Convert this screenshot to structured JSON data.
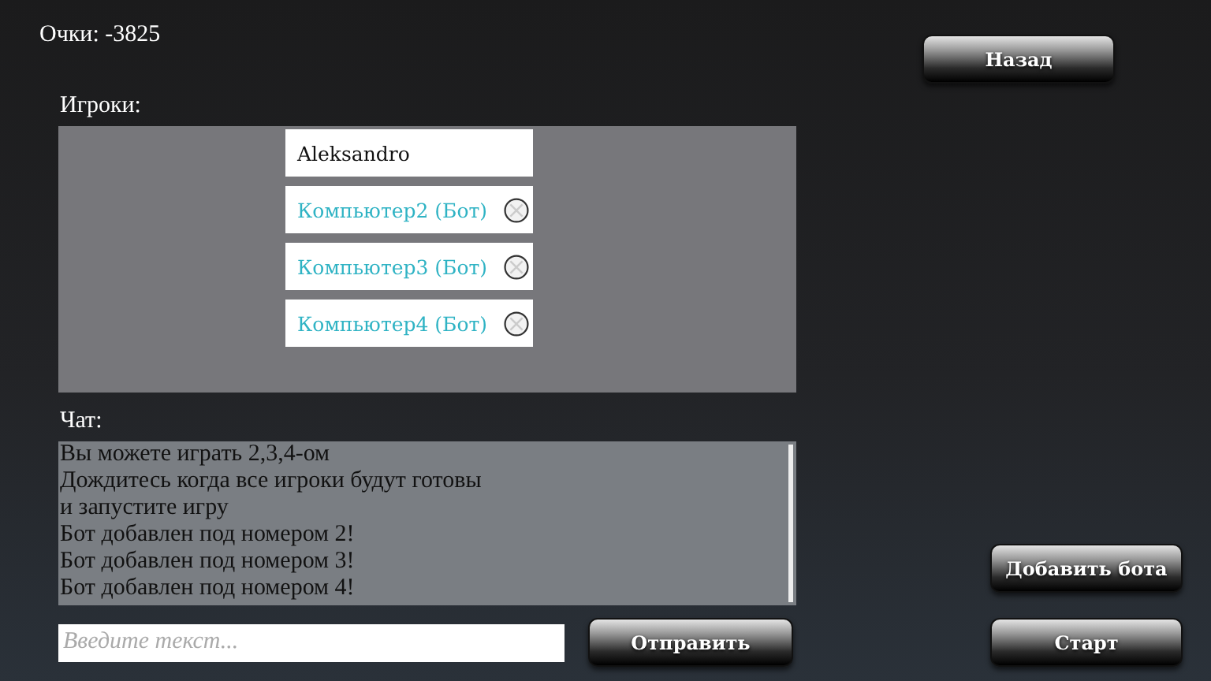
{
  "score": {
    "label": "Очки: -3825"
  },
  "back_button": "Назад",
  "players_label": "Игроки:",
  "players": [
    {
      "name": "Aleksandro",
      "kind": "human"
    },
    {
      "name": "Компьютер2 (Бот)",
      "kind": "bot"
    },
    {
      "name": "Компьютер3 (Бот)",
      "kind": "bot"
    },
    {
      "name": "Компьютер4 (Бот)",
      "kind": "bot"
    }
  ],
  "chat_label": "Чат:",
  "chat_messages": [
    "Вы можете играть 2,3,4-ом",
    "Дождитесь когда все игроки будут готовы",
    "и запустите игру",
    "Бот добавлен под номером 2!",
    "Бот добавлен под номером 3!",
    "Бот добавлен под номером 4!"
  ],
  "chat_input": {
    "placeholder": "Введите текст..."
  },
  "send_button": "Отправить",
  "add_bot_button": "Добавить бота",
  "start_button": "Старт"
}
